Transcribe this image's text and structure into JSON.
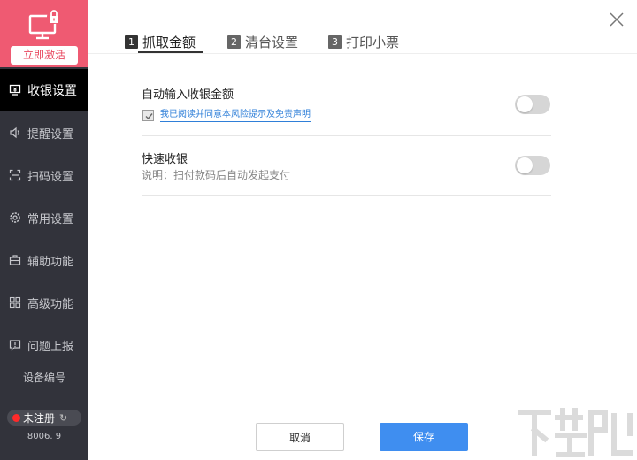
{
  "sidebar": {
    "activate_label": "立即激活",
    "items": [
      {
        "label": "收银设置",
        "icon": "cash-register-icon",
        "active": true
      },
      {
        "label": "提醒设置",
        "icon": "speaker-icon",
        "active": false
      },
      {
        "label": "扫码设置",
        "icon": "scan-icon",
        "active": false
      },
      {
        "label": "常用设置",
        "icon": "gear-icon",
        "active": false
      },
      {
        "label": "辅助功能",
        "icon": "toolbox-icon",
        "active": false
      },
      {
        "label": "高级功能",
        "icon": "grid-icon",
        "active": false
      },
      {
        "label": "问题上报",
        "icon": "report-icon",
        "active": false
      }
    ],
    "device_id_label": "设备编号",
    "registration_status": "未注册",
    "version": "8006. 9"
  },
  "tabs": [
    {
      "num": "1",
      "label": "抓取金额",
      "active": true
    },
    {
      "num": "2",
      "label": "清台设置",
      "active": false
    },
    {
      "num": "3",
      "label": "打印小票",
      "active": false
    }
  ],
  "settings": {
    "auto_input": {
      "title": "自动输入收银金额",
      "agreement": "我已阅读并同意本风险提示及免责声明",
      "agreement_checked": true,
      "enabled": false
    },
    "quick_pay": {
      "title": "快速收银",
      "description": "说明：扫付款码后自动发起支付",
      "enabled": false
    }
  },
  "footer": {
    "cancel_label": "取消",
    "save_label": "保存"
  },
  "colors": {
    "accent": "#3f8ef0",
    "activate_bg": "#ef5a72",
    "sidebar_bg": "#32333b",
    "active_item_bg": "#000000",
    "link": "#2f7fd8"
  }
}
